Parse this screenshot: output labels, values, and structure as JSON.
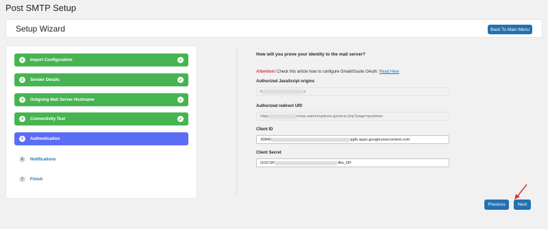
{
  "page": {
    "title": "Post SMTP Setup"
  },
  "header": {
    "title": "Setup Wizard",
    "back_label": "Back To Main Menu"
  },
  "steps": [
    {
      "number": "1",
      "label": "Import Configuration",
      "status": "done"
    },
    {
      "number": "2",
      "label": "Sender Details",
      "status": "done"
    },
    {
      "number": "3",
      "label": "Outgoing Mail Server Hostname",
      "status": "done"
    },
    {
      "number": "4",
      "label": "Connectivity Test",
      "status": "done"
    },
    {
      "number": "5",
      "label": "Authentication",
      "status": "active"
    },
    {
      "number": "6",
      "label": "Notifications",
      "status": "pending"
    },
    {
      "number": "7",
      "label": "Finish",
      "status": "pending"
    }
  ],
  "content": {
    "question": "How will you prove your identity to the mail server?",
    "notice_attention": "Attention!",
    "notice_text": "Check this article how to configure Gmail/Gsuite OAuth:",
    "notice_link": "Read Here",
    "js_origins_label": "Authorized JavaScript origins",
    "js_origins_value_start": "h",
    "js_origins_value_end": "s",
    "redirect_label": "Authorized redirect URI",
    "redirect_value_start": "https",
    "redirect_value_end": "m/wp-admin/options-general.php?page=postman",
    "client_id_label": "Client ID",
    "client_id_value_start": "30840",
    "client_id_value_end": "qgfo.apps.googleusercontent.com",
    "client_secret_label": "Client Secret",
    "client_secret_value_start": "GOCSP",
    "client_secret_value_end": "4lw_DP"
  },
  "footer": {
    "previous_label": "Previous",
    "next_label": "Next"
  },
  "colors": {
    "done": "#46b450",
    "active": "#5b6cf5",
    "primary": "#2271b1",
    "attention": "#d63638"
  }
}
